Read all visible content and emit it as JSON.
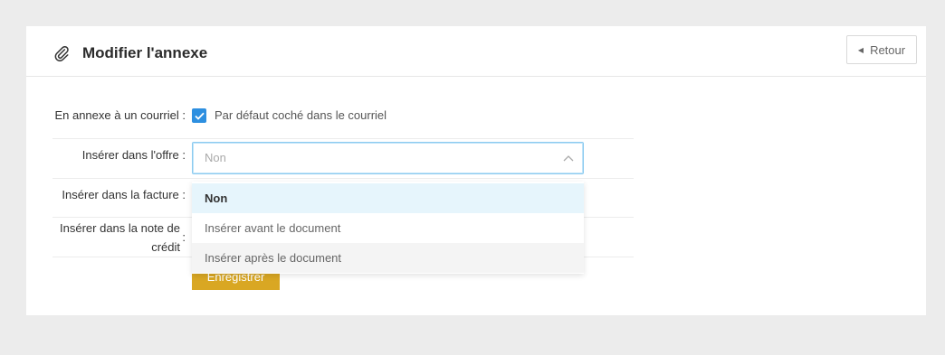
{
  "header": {
    "title": "Modifier l'annexe",
    "back_label": "Retour"
  },
  "icons": {
    "title_icon": "paperclip-icon",
    "back_icon": "caret-left-icon"
  },
  "form": {
    "courriel_label": "En annexe à un courriel :",
    "courriel_checkbox_label": "Par défaut coché dans le courriel",
    "courriel_checked": true,
    "offre_label": "Insérer dans l'offre :",
    "offre_value": "Non",
    "facture_label": "Insérer dans la facture :",
    "note_label_line1": "Insérer dans la note de",
    "note_label_line2": "crédit",
    "note_colon": ":",
    "save_label": "Enregistrer"
  },
  "dropdown": {
    "options": [
      "Non",
      "Insérer avant le document",
      "Insérer après le document"
    ],
    "selected_index": 0,
    "hover_index": 2
  },
  "colors": {
    "accent": "#2d8fe0",
    "save_button": "#d9a723",
    "selected_option_bg": "#e6f5fc"
  }
}
